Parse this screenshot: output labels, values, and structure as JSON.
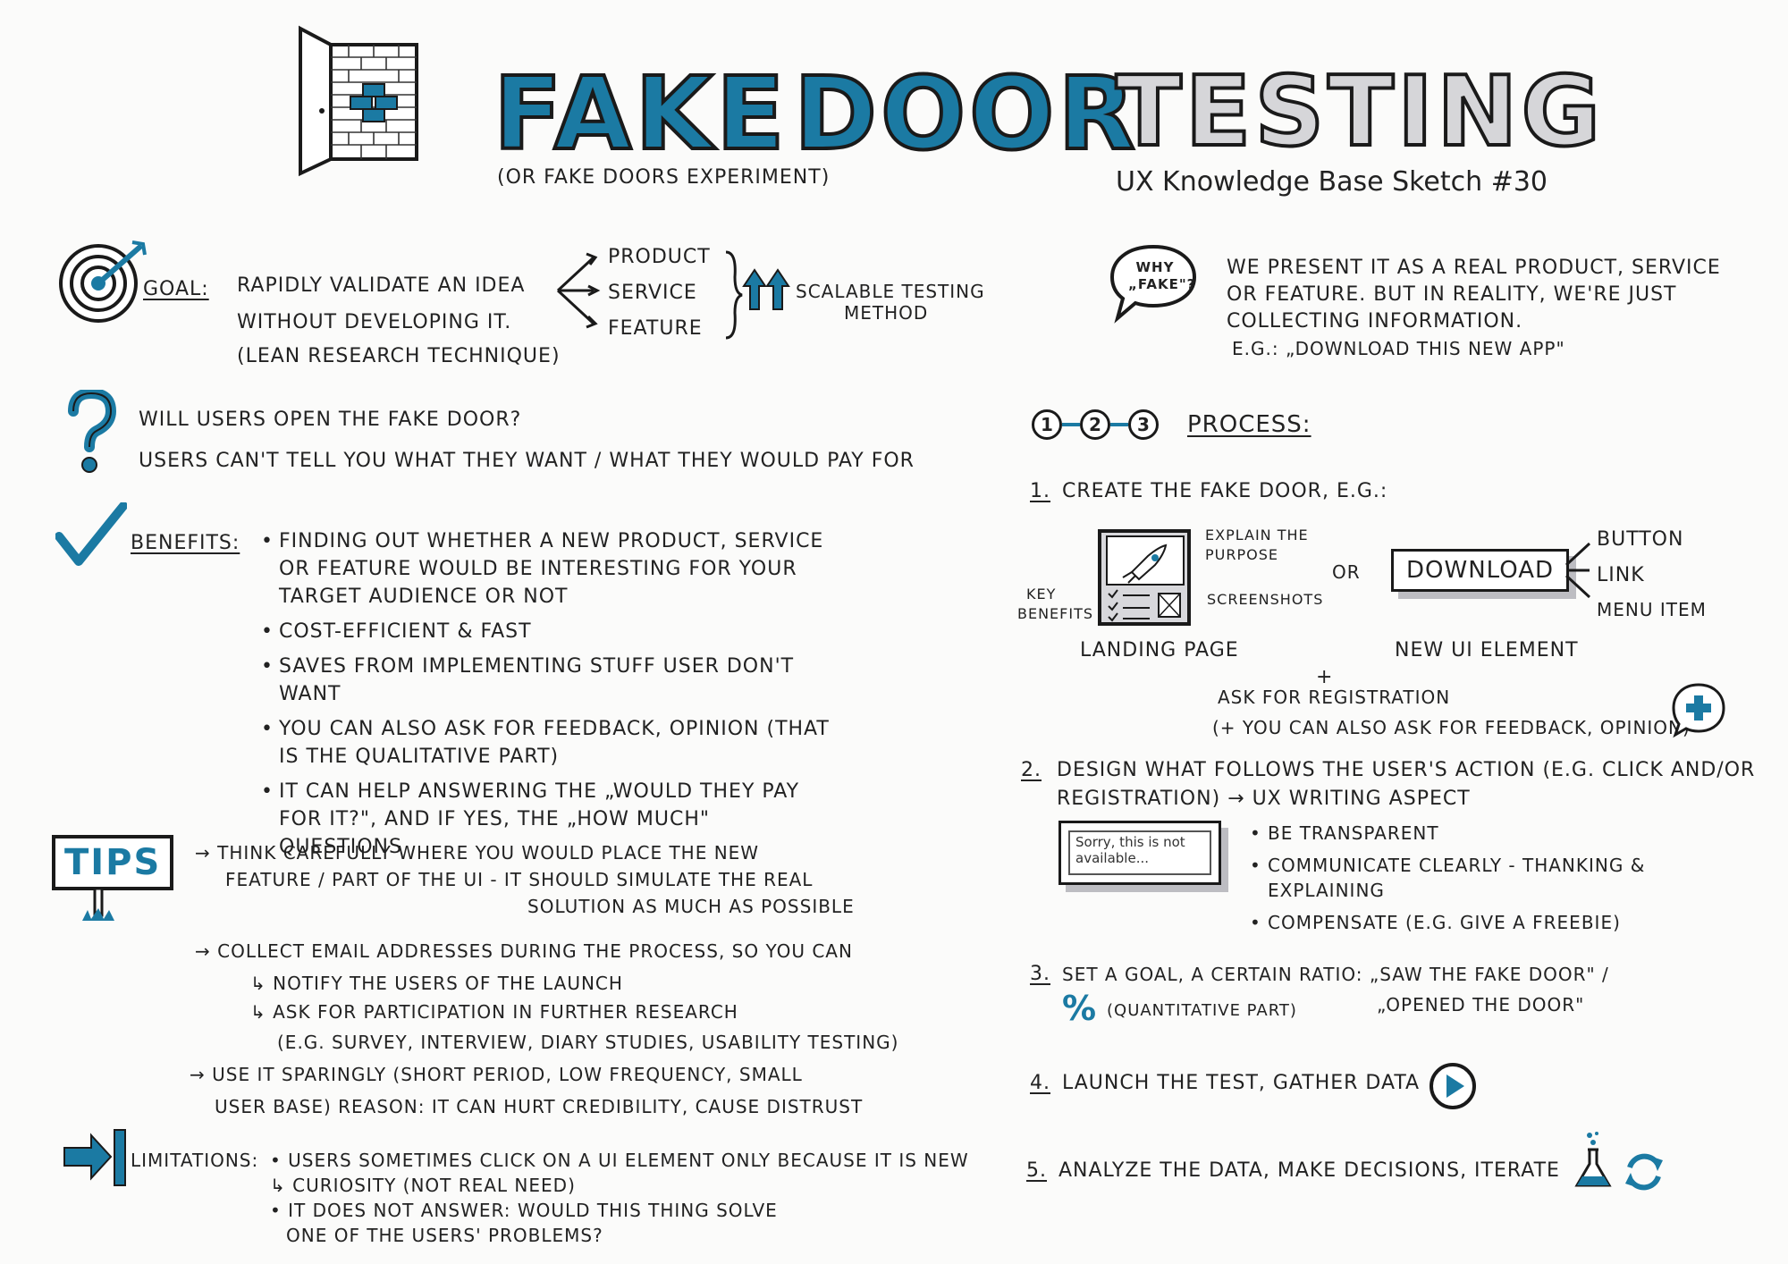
{
  "header": {
    "title_fake": "FAKE",
    "title_door": "DOOR",
    "title_testing": "TESTING",
    "subtitle": "(OR FAKE DOORS EXPERIMENT)",
    "series": "UX Knowledge Base Sketch #30"
  },
  "goal": {
    "label": "GOAL:",
    "line1": "RAPIDLY VALIDATE AN IDEA",
    "line2": "WITHOUT DEVELOPING IT.",
    "line3": "(LEAN RESEARCH TECHNIQUE)",
    "options": [
      "PRODUCT",
      "SERVICE",
      "FEATURE"
    ],
    "scalable": "SCALABLE TESTING",
    "method": "METHOD"
  },
  "question": {
    "line1": "WILL USERS OPEN THE FAKE DOOR?",
    "line2": "USERS CAN'T TELL YOU WHAT THEY WANT / WHAT THEY WOULD PAY FOR"
  },
  "benefits": {
    "label": "BENEFITS:",
    "items": [
      "FINDING OUT WHETHER A NEW PRODUCT, SERVICE OR FEATURE WOULD BE INTERESTING FOR YOUR TARGET AUDIENCE OR NOT",
      "COST-EFFICIENT & FAST",
      "SAVES FROM IMPLEMENTING STUFF USER DON'T WANT",
      "YOU CAN ALSO ASK FOR FEEDBACK, OPINION (THAT IS THE QUALITATIVE PART)",
      "IT CAN HELP ANSWERING THE „WOULD THEY PAY FOR IT?\", AND IF YES, THE „HOW MUCH\" QUESTIONS"
    ]
  },
  "tips": {
    "label": "TIPS",
    "tip1_line1": "→ THINK CAREFULLY WHERE YOU WOULD PLACE THE NEW",
    "tip1_line2": "FEATURE / PART OF THE UI - IT SHOULD SIMULATE THE REAL",
    "tip1_line3": "SOLUTION AS MUCH AS POSSIBLE",
    "tip2_line1": "→ COLLECT EMAIL ADDRESSES DURING THE PROCESS, SO YOU CAN",
    "tip2_sub1": "↳ NOTIFY THE USERS OF THE LAUNCH",
    "tip2_sub2": "↳ ASK FOR PARTICIPATION IN FURTHER RESEARCH",
    "tip2_sub3": "(E.G. SURVEY, INTERVIEW, DIARY STUDIES, USABILITY TESTING)",
    "tip3_line1": "→ USE IT SPARINGLY (SHORT PERIOD, LOW FREQUENCY, SMALL",
    "tip3_line2": "USER BASE) REASON: IT CAN HURT CREDIBILITY, CAUSE DISTRUST"
  },
  "limitations": {
    "label": "LIMITATIONS:",
    "item1": "• USERS SOMETIMES CLICK ON A UI ELEMENT ONLY BECAUSE IT IS NEW",
    "item1_sub": "↳ CURIOSITY (NOT REAL NEED)",
    "item2_line1": "• IT DOES NOT ANSWER: WOULD THIS THING SOLVE",
    "item2_line2": "ONE OF THE USERS' PROBLEMS?"
  },
  "why_fake": {
    "bubble": "WHY „FAKE\"?",
    "line1": "WE PRESENT IT AS A REAL PRODUCT, SERVICE",
    "line2": "OR FEATURE. BUT IN REALITY, WE'RE JUST",
    "line3": "COLLECTING INFORMATION.",
    "line4": "E.G.: „DOWNLOAD THIS NEW APP\""
  },
  "process": {
    "steps_icon": [
      "1",
      "2",
      "3"
    ],
    "label": "PROCESS:",
    "step1": {
      "num": "1.",
      "text": "CREATE THE FAKE DOOR, E.G.:"
    },
    "landing": {
      "explain": "EXPLAIN THE PURPOSE",
      "key": "KEY",
      "benefits": "BENEFITS",
      "screenshots": "SCREENSHOTS",
      "caption": "LANDING PAGE"
    },
    "or": "OR",
    "download": "DOWNLOAD",
    "ui_options": [
      "BUTTON",
      "LINK",
      "MENU ITEM"
    ],
    "ui_caption": "NEW UI ELEMENT",
    "plus": "+",
    "registration": "ASK FOR REGISTRATION",
    "registration_note": "(+ YOU CAN ALSO ASK FOR FEEDBACK, OPINION)",
    "step2": {
      "num": "2.",
      "line1": "DESIGN WHAT FOLLOWS THE USER'S ACTION (E.G. CLICK AND/OR",
      "line2": "REGISTRATION) → UX WRITING ASPECT",
      "sorry": "Sorry, this is not available...",
      "items": [
        "BE TRANSPARENT",
        "COMMUNICATE CLEARLY - THANKING & EXPLAINING",
        "COMPENSATE (E.G. GIVE A FREEBIE)"
      ]
    },
    "step3": {
      "num": "3.",
      "line1": "SET A GOAL, A CERTAIN RATIO: „SAW THE FAKE DOOR\" /",
      "percent": "%",
      "quant": "(QUANTITATIVE PART)",
      "line2": "„OPENED THE DOOR\""
    },
    "step4": {
      "num": "4.",
      "text": "LAUNCH THE TEST, GATHER DATA"
    },
    "step5": {
      "num": "5.",
      "text": "ANALYZE THE DATA, MAKE DECISIONS, ITERATE"
    }
  }
}
